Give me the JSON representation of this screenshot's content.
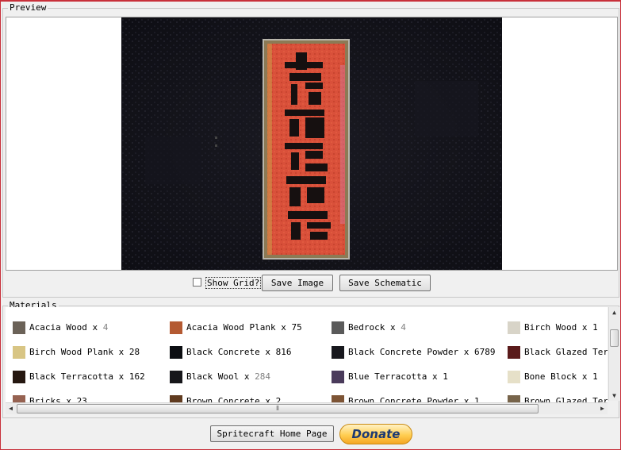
{
  "preview": {
    "legend": "Preview",
    "show_grid_label": "Show Grid?",
    "show_grid_checked": false,
    "save_image_label": "Save Image",
    "save_schematic_label": "Save Schematic"
  },
  "materials": {
    "legend": "Materials",
    "items": [
      {
        "name": "Acacia Wood",
        "count": "4",
        "muted": true,
        "icon": "acacia-wood-icon",
        "color": "#6b6258"
      },
      {
        "name": "Acacia Wood Plank",
        "count": "75",
        "muted": false,
        "icon": "acacia-wood-plank-icon",
        "color": "#b45a32"
      },
      {
        "name": "Bedrock",
        "count": "4",
        "muted": true,
        "icon": "bedrock-icon",
        "color": "#5a5a5a"
      },
      {
        "name": "Birch Wood",
        "count": "1",
        "muted": false,
        "icon": "birch-wood-icon",
        "color": "#d8d4c8"
      },
      {
        "name": "Birch Wood Plank",
        "count": "28",
        "muted": false,
        "icon": "birch-wood-plank-icon",
        "color": "#d8c584"
      },
      {
        "name": "Black Concrete",
        "count": "816",
        "muted": false,
        "icon": "black-concrete-icon",
        "color": "#0c0e12"
      },
      {
        "name": "Black Concrete Powder",
        "count": "6789",
        "muted": false,
        "icon": "black-concrete-powder-icon",
        "color": "#17181d"
      },
      {
        "name": "Black Glazed Terr",
        "count": "",
        "muted": false,
        "icon": "black-glazed-terracotta-icon",
        "color": "#5a1a1a"
      },
      {
        "name": "Black Terracotta",
        "count": "162",
        "muted": false,
        "icon": "black-terracotta-icon",
        "color": "#251710"
      },
      {
        "name": "Black Wool",
        "count": "284",
        "muted": true,
        "icon": "black-wool-icon",
        "color": "#16161a"
      },
      {
        "name": "Blue Terracotta",
        "count": "1",
        "muted": false,
        "icon": "blue-terracotta-icon",
        "color": "#4a3b5b"
      },
      {
        "name": "Bone Block",
        "count": "1",
        "muted": false,
        "icon": "bone-block-icon",
        "color": "#e6e0c8"
      },
      {
        "name": "Bricks",
        "count": "23",
        "muted": false,
        "icon": "bricks-icon",
        "color": "#966251"
      },
      {
        "name": "Brown Concrete",
        "count": "2",
        "muted": false,
        "icon": "brown-concrete-icon",
        "color": "#603b1f"
      },
      {
        "name": "Brown Concrete Powder",
        "count": "1",
        "muted": false,
        "icon": "brown-concrete-powder-icon",
        "color": "#7d5435"
      },
      {
        "name": "Brown Glazed Terr",
        "count": "",
        "muted": false,
        "icon": "brown-glazed-terracotta-icon",
        "color": "#77644a"
      }
    ]
  },
  "footer": {
    "home_page_label": "Spritecraft Home Page",
    "donate_label": "Donate"
  }
}
